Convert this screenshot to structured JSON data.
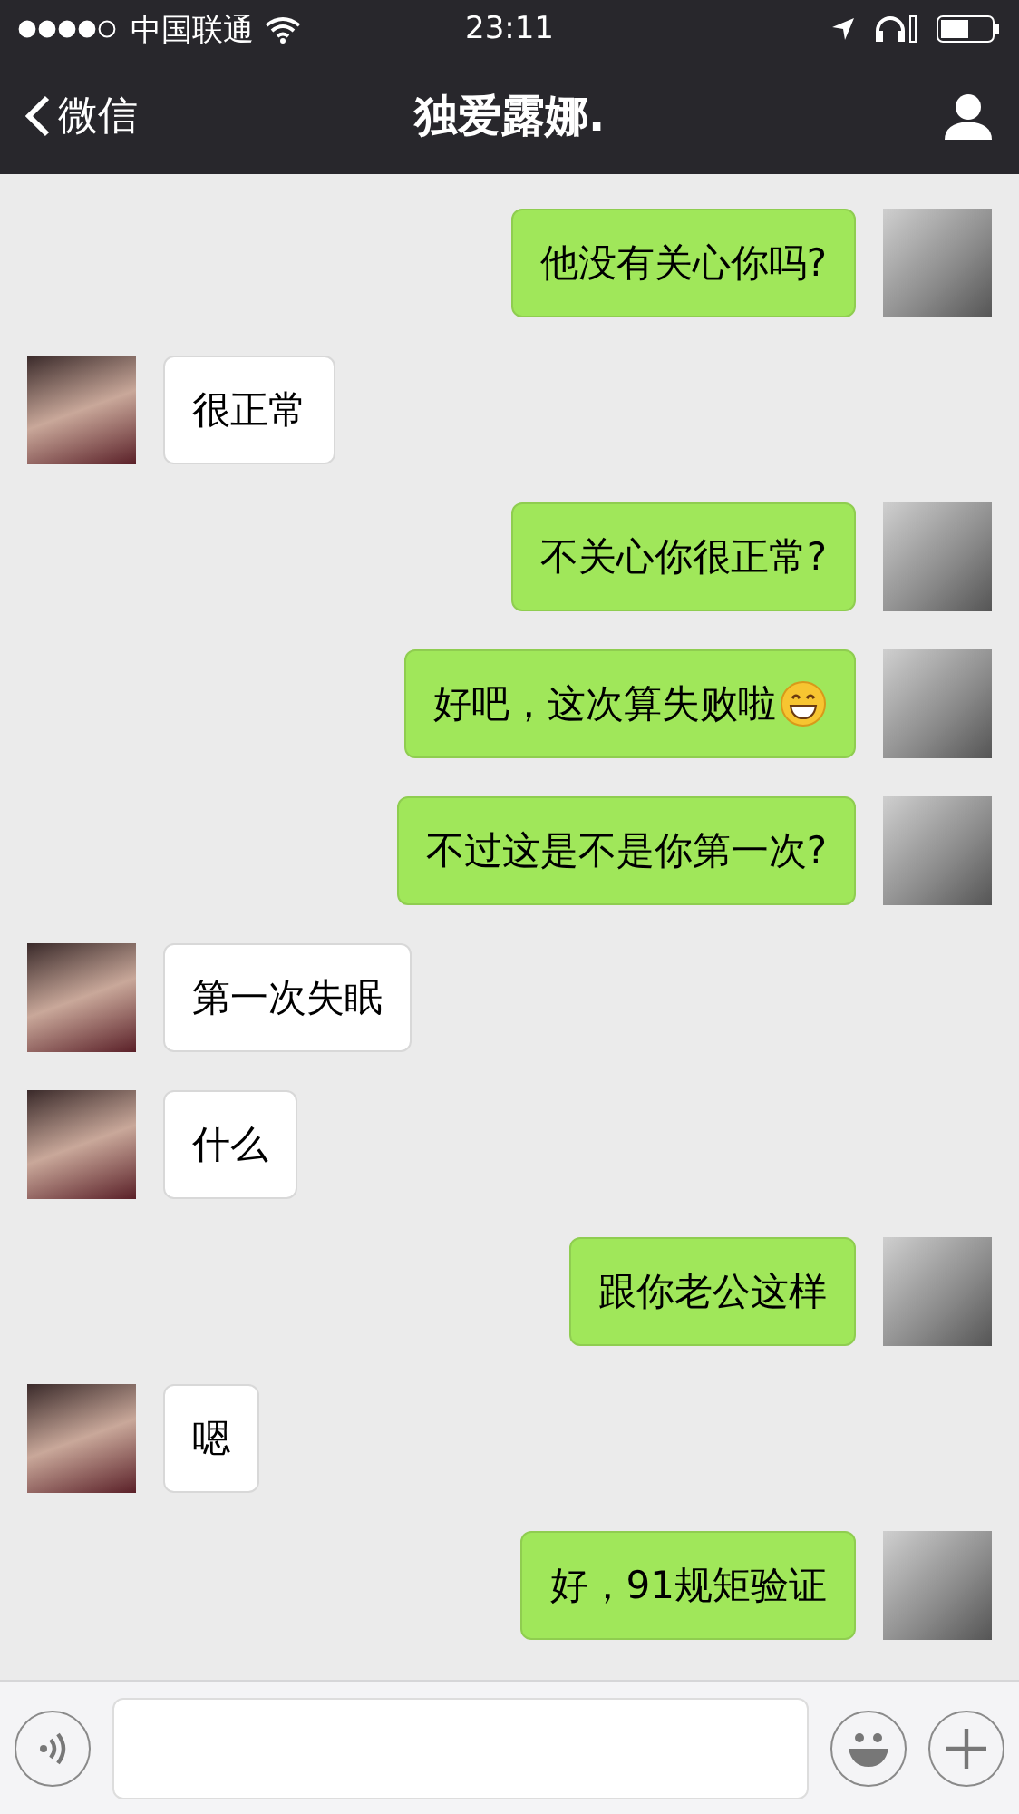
{
  "status_bar": {
    "carrier": "中国联通",
    "time": "23:11"
  },
  "nav": {
    "back": "微信",
    "title": "独爱露娜."
  },
  "messages": [
    {
      "kind": "sent",
      "text": "他没有关心你吗?",
      "emoji": false
    },
    {
      "kind": "received",
      "text": "很正常",
      "emoji": false
    },
    {
      "kind": "sent",
      "text": "不关心你很正常?",
      "emoji": false
    },
    {
      "kind": "sent",
      "text": "好吧，这次算失败啦",
      "emoji": true
    },
    {
      "kind": "sent",
      "text": "不过这是不是你第一次?",
      "emoji": false
    },
    {
      "kind": "received",
      "text": "第一次失眠",
      "emoji": false
    },
    {
      "kind": "received",
      "text": "什么",
      "emoji": false
    },
    {
      "kind": "sent",
      "text": "跟你老公这样",
      "emoji": false
    },
    {
      "kind": "received",
      "text": "嗯",
      "emoji": false
    },
    {
      "kind": "sent",
      "text": "好，91规矩验证",
      "emoji": false
    }
  ]
}
